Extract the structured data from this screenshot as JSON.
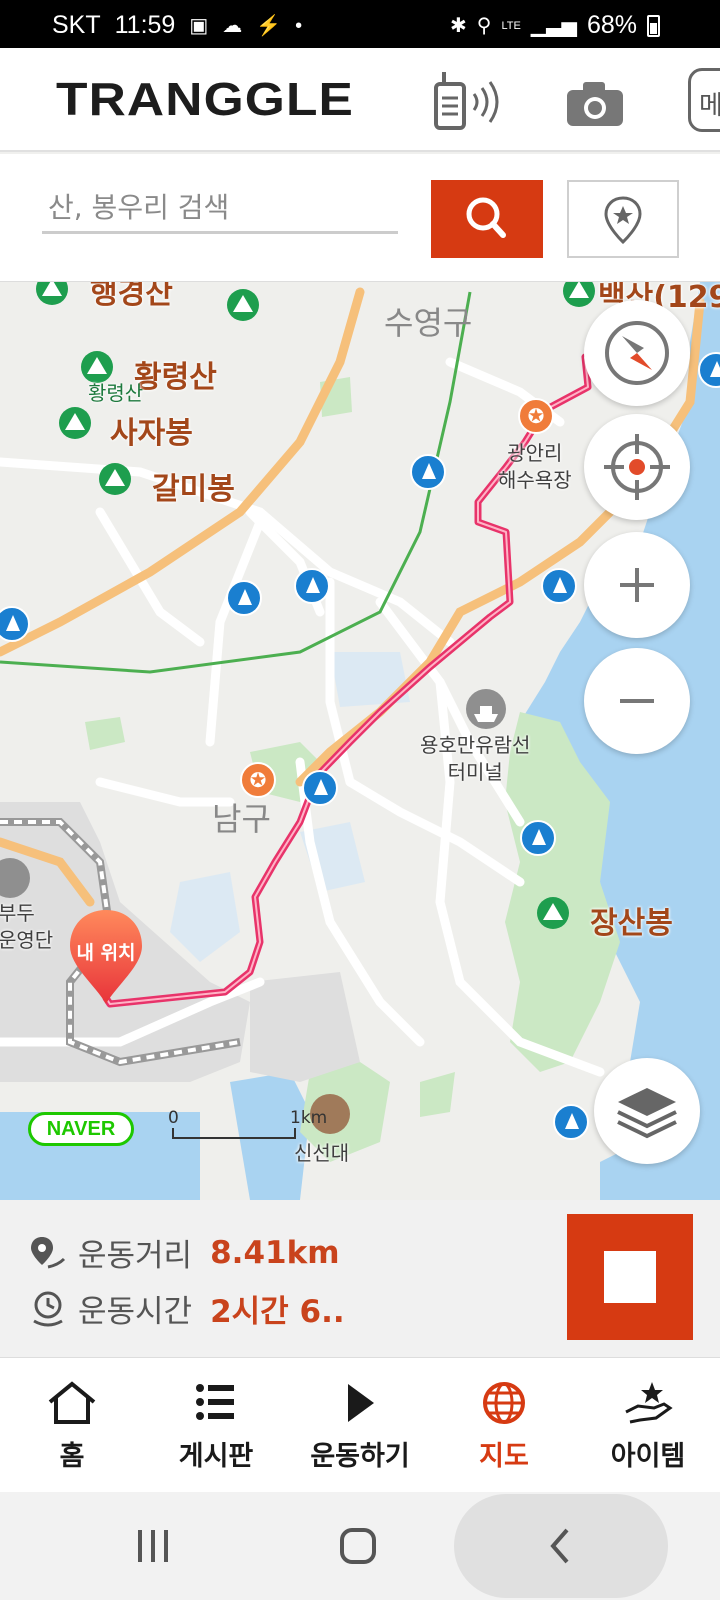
{
  "status_bar": {
    "carrier": "SKT",
    "time": "11:59",
    "network": "LTE",
    "battery": "68%"
  },
  "header": {
    "logo": "TRANGGLE",
    "menu_partial": "메"
  },
  "search": {
    "placeholder": "산, 봉우리 검색"
  },
  "map": {
    "peaks": {
      "haengsan": "행경산",
      "hwangnyeongsan": "황령산",
      "hwangnyeongsan_small": "황령산",
      "sajabong": "사자봉",
      "galmibong": "갈미봉",
      "jangsanbong": "장산봉",
      "baeksan": "백산(129"
    },
    "districts": {
      "suyeong": "수영구",
      "nam": "남구"
    },
    "pois": {
      "gwangalli_1": "광안리",
      "gwangalli_2": "해수욕장",
      "yongho_1": "용호만유람선",
      "yongho_2": "터미널",
      "sinseondae": "신선대",
      "pier_1": "부두",
      "pier_2": "운영단"
    },
    "my_location": "내 위치",
    "attribution": "NAVER",
    "scale": {
      "start": "0",
      "end": "1km"
    }
  },
  "stats": {
    "distance_label": "운동거리",
    "distance_value": "8.41km",
    "time_label": "운동시간",
    "time_value": "2시간 6.."
  },
  "nav": {
    "items": [
      {
        "label": "홈",
        "icon": "home-icon"
      },
      {
        "label": "게시판",
        "icon": "list-icon"
      },
      {
        "label": "운동하기",
        "icon": "play-icon"
      },
      {
        "label": "지도",
        "icon": "globe-icon",
        "active": true
      },
      {
        "label": "아이템",
        "icon": "hand-star-icon"
      }
    ]
  },
  "colors": {
    "accent": "#d63a12",
    "route": "#e8336a",
    "water": "#a9d3f1",
    "park": "#cbe8c4",
    "label_brown": "#a3471a"
  }
}
